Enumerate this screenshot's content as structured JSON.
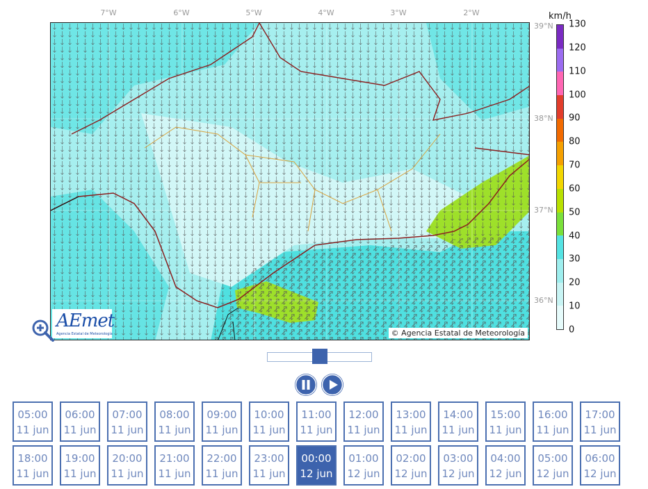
{
  "map": {
    "longitude_labels": [
      "7°W",
      "6°W",
      "5°W",
      "4°W",
      "3°W",
      "2°W"
    ],
    "latitude_labels": [
      "39°N",
      "38°N",
      "37°N",
      "36°N"
    ],
    "copyright": "© Agencia Estatal de Meteorología",
    "logo_text": "AEmet",
    "logo_subtext": "Agencia Estatal de Meteorología",
    "zoom_icon": "zoom-in-icon"
  },
  "legend": {
    "unit": "km/h",
    "ticks": [
      "130",
      "120",
      "110",
      "100",
      "90",
      "80",
      "70",
      "60",
      "50",
      "40",
      "30",
      "20",
      "10",
      "0"
    ],
    "colors": [
      "#e6fbfb",
      "#c8f4f4",
      "#9eeeee",
      "#55e3e3",
      "#7ae03a",
      "#b8e000",
      "#f2d600",
      "#f5a000",
      "#f26a00",
      "#e23d2b",
      "#ff66b3",
      "#9b6cf0",
      "#7a2bc2"
    ]
  },
  "player": {
    "pause_icon": "pause-icon",
    "play_icon": "play-icon",
    "position_fraction": 0.5
  },
  "times": [
    {
      "time": "05:00",
      "date": "11 jun"
    },
    {
      "time": "06:00",
      "date": "11 jun"
    },
    {
      "time": "07:00",
      "date": "11 jun"
    },
    {
      "time": "08:00",
      "date": "11 jun"
    },
    {
      "time": "09:00",
      "date": "11 jun"
    },
    {
      "time": "10:00",
      "date": "11 jun"
    },
    {
      "time": "11:00",
      "date": "11 jun"
    },
    {
      "time": "12:00",
      "date": "11 jun"
    },
    {
      "time": "13:00",
      "date": "11 jun"
    },
    {
      "time": "14:00",
      "date": "11 jun"
    },
    {
      "time": "15:00",
      "date": "11 jun"
    },
    {
      "time": "16:00",
      "date": "11 jun"
    },
    {
      "time": "17:00",
      "date": "11 jun"
    },
    {
      "time": "18:00",
      "date": "11 jun"
    },
    {
      "time": "19:00",
      "date": "11 jun"
    },
    {
      "time": "20:00",
      "date": "11 jun"
    },
    {
      "time": "21:00",
      "date": "11 jun"
    },
    {
      "time": "22:00",
      "date": "11 jun"
    },
    {
      "time": "23:00",
      "date": "11 jun"
    },
    {
      "time": "00:00",
      "date": "12 jun",
      "active": true
    },
    {
      "time": "01:00",
      "date": "12 jun"
    },
    {
      "time": "02:00",
      "date": "12 jun"
    },
    {
      "time": "03:00",
      "date": "12 jun"
    },
    {
      "time": "04:00",
      "date": "12 jun"
    },
    {
      "time": "05:00",
      "date": "12 jun"
    },
    {
      "time": "06:00",
      "date": "12 jun"
    }
  ]
}
